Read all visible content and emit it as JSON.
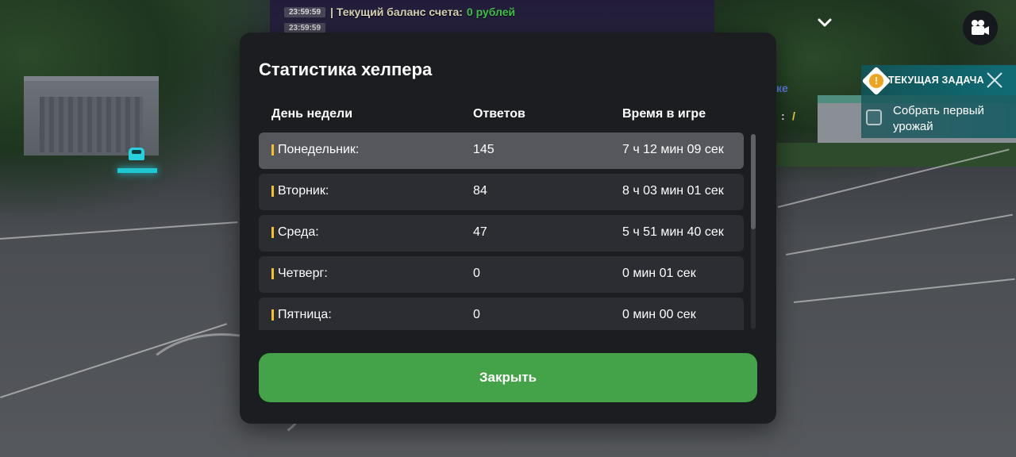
{
  "chat": {
    "lines": [
      {
        "time": "23:59:59",
        "text": "| Текущий баланс счета:",
        "money": "0 рублей"
      },
      {
        "time": "23:59:59",
        "dashes": "________________________________"
      }
    ],
    "partial_blue": "ке",
    "partial_colon": ":",
    "partial_slash": "/"
  },
  "top_controls": {
    "chevron_icon": "chevron-down-icon",
    "camera_icon": "video-camera-icon"
  },
  "task_panel": {
    "title": "ТЕКУЩАЯ ЗАДАЧА",
    "item": "Собрать первый урожай",
    "accent_color": "#f0a41e"
  },
  "dialog": {
    "title": "Статистика хелпера",
    "columns": {
      "day": "День недели",
      "answers": "Ответов",
      "time": "Время в игре"
    },
    "rows": [
      {
        "day": "Понедельник:",
        "answers": "145",
        "time": "7 ч 12 мин 09 сек",
        "selected": true
      },
      {
        "day": "Вторник:",
        "answers": "84",
        "time": "8 ч 03 мин 01 сек",
        "selected": false
      },
      {
        "day": "Среда:",
        "answers": "47",
        "time": "5 ч 51 мин 40 сек",
        "selected": false
      },
      {
        "day": "Четверг:",
        "answers": "0",
        "time": "0 мин 01 сек",
        "selected": false
      },
      {
        "day": "Пятница:",
        "answers": "0",
        "time": "0 мин 00 сек",
        "selected": false
      }
    ],
    "close_label": "Закрыть",
    "marker_color": "#f5c02a",
    "close_color": "#44a348"
  }
}
